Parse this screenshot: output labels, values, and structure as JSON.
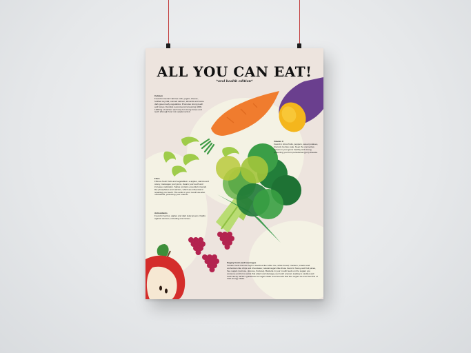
{
  "poster": {
    "title": "ALL YOU CAN EAT!",
    "subtitle": "*oral health edition*",
    "sections": [
      {
        "heading": "Calcium",
        "body": "Found in low-fat / fat-free milk, yogurt, cheese, fortified soymilk, canned salmon, almonds and some dark green leafy vegetables. Promotes strong teeth and bones. Dentists recommend consuming 1000-1200mg of calcium each day for strong bones and teeth (through food not supplements!)"
      },
      {
        "heading": "Vitamin C",
        "body": "Found in citrus fruits, peppers, sweet potatoes, broccoli, berries, kale. Keep the connective tissues in your gums healthy and strong, protecting you from periodontal (gum) disease."
      },
      {
        "heading": "Fibre",
        "body": "Fibrous fresh fruits and vegetables i.e apples, carrots and celery, massages your gums, cleans your teeth and increases salivation. Saliva contains essential minerals like phosphates and calcium, which are influential in repairing your teeth. The acids in your mouth are also neutralised, protecting your enamel."
      },
      {
        "heading": "Antioxidants",
        "body": "Found in berries, apples and dark leafy greens. Fights against cancers, including oral cancer."
      },
      {
        "heading": "Sugary foods and beverages",
        "body": "Include foods that are high in starches like white rice, white bread, crackers, snacks and confections like chips and chocolates; natural sugars like those found in honey and fruit juices, free sugars (sucrose, glucose, fructose). Bacteria in your mouth feeds on the sugars you consume and forms acids that attack and damage your tooth enamel, leading to cavities and tooth decay. WHO's guidelines for sugar intake recommends that free sugars be less than 5% of total energy intake."
      }
    ]
  },
  "illustrations": [
    "carrot",
    "sweet-potato",
    "celery-slices",
    "broccoli",
    "raspberries",
    "apple"
  ],
  "colors": {
    "background": "#e8eaec",
    "poster": "#ede4de",
    "carrot": "#f07c2e",
    "sweet_potato_skin": "#6a3f8e",
    "sweet_potato_flesh": "#f4b61d",
    "celery": "#9fcc4a",
    "broccoli": "#2e9342",
    "raspberry": "#b3234f",
    "apple": "#d42d2b",
    "wire": "#c23b3b"
  }
}
